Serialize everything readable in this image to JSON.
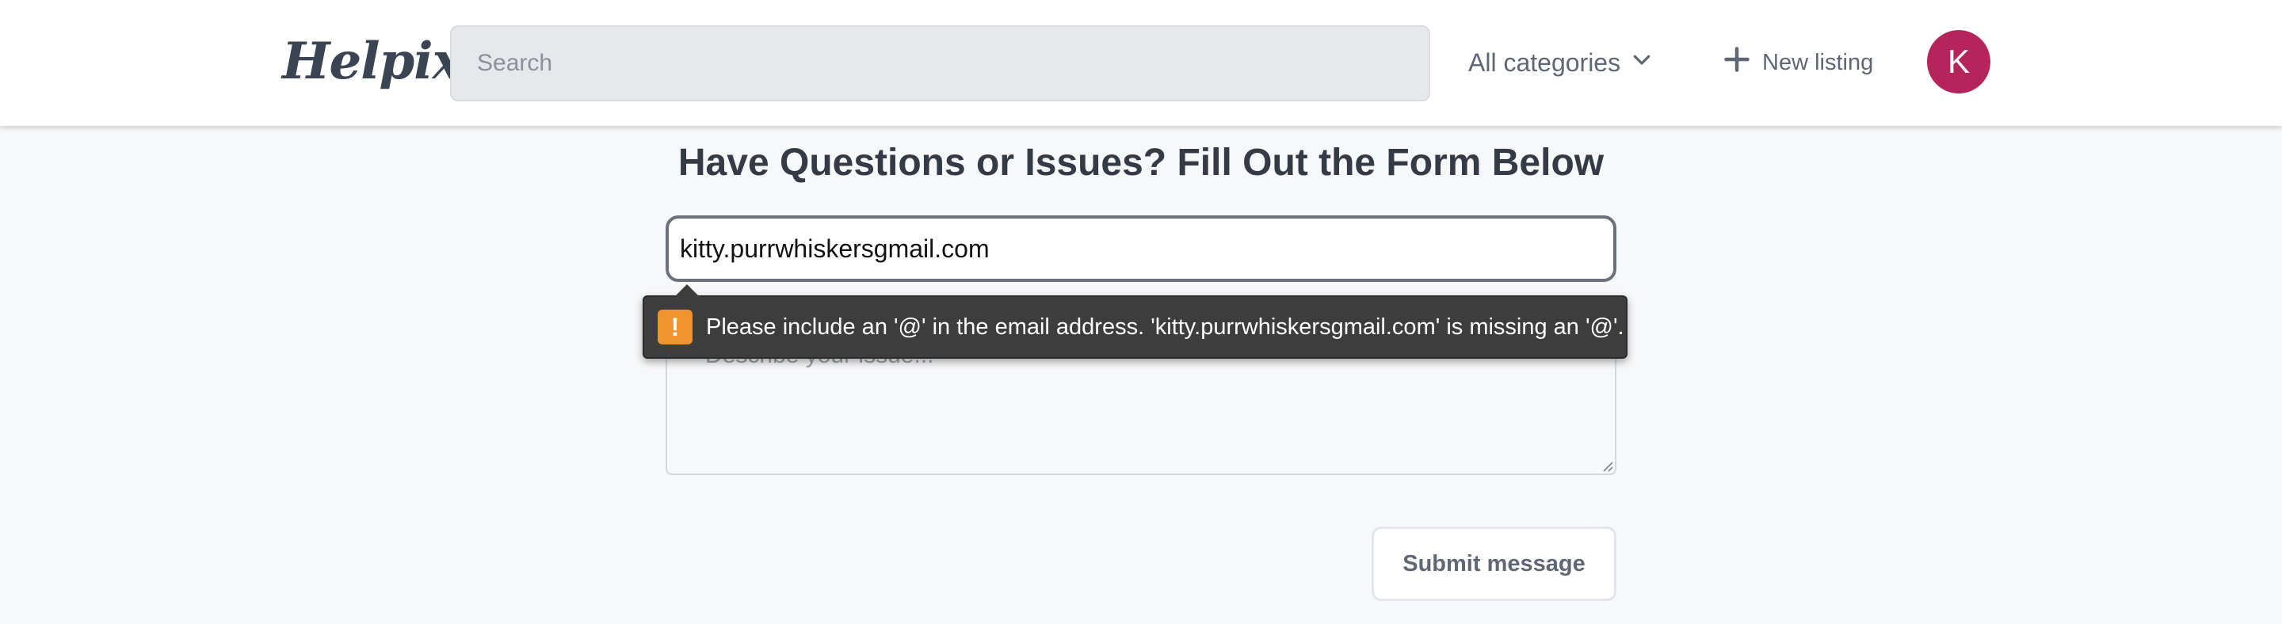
{
  "header": {
    "logo": "Helpix",
    "search_placeholder": "Search",
    "categories_label": "All categories",
    "new_listing_label": "New listing",
    "avatar_initial": "K"
  },
  "form": {
    "heading": "Have Questions or Issues? Fill Out the Form Below",
    "email_value": "kitty.purrwhiskersgmail.com",
    "message_placeholder": "Describe your issue...",
    "submit_label": "Submit message"
  },
  "validation": {
    "message": "Please include an '@' in the email address. 'kitty.purrwhiskersgmail.com' is missing an '@'.",
    "icon": "!"
  },
  "colors": {
    "avatar_bg": "#b5245a",
    "warning_icon": "#f0952e",
    "tooltip_bg": "#3d3d3d"
  }
}
